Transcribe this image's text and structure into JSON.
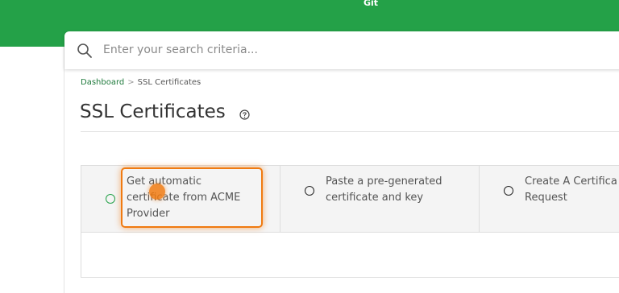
{
  "topbar": {
    "title": "Git"
  },
  "search": {
    "placeholder": "Enter your search criteria..."
  },
  "breadcrumb": {
    "home": "Dashboard",
    "separator": ">",
    "current": "SSL Certificates"
  },
  "page": {
    "title": "SSL Certificates"
  },
  "options": [
    {
      "label": "Get automatic certificate from ACME Provider",
      "lines": [
        "Get automatic",
        "certificate from ACME",
        "Provider"
      ],
      "selected": false
    },
    {
      "label": "Paste a pre-generated certificate and key",
      "lines": [
        "Paste a pre-generated",
        "certificate and key"
      ],
      "selected": false
    },
    {
      "label": "Create A Certificate Request",
      "lines": [
        "Create A Certifica",
        "Request"
      ],
      "selected": false
    }
  ],
  "colors": {
    "brand": "#24a148",
    "highlight": "#f07a10",
    "link": "#1f7a3c"
  },
  "icons": {
    "search": "search-icon",
    "help": "help-circle-icon",
    "radio": "radio-icon"
  }
}
